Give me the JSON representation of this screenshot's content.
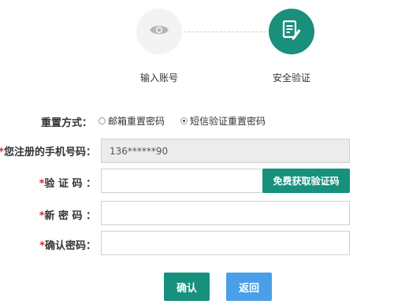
{
  "steps": [
    {
      "label": "输入账号",
      "icon": "eye-icon",
      "state": "inactive"
    },
    {
      "label": "安全验证",
      "icon": "edit-document-icon",
      "state": "active"
    }
  ],
  "form": {
    "reset_method": {
      "label": "重置方式：",
      "options": [
        {
          "label": "邮箱重置密码",
          "checked": false
        },
        {
          "label": "短信验证重置密码",
          "checked": true
        }
      ]
    },
    "phone": {
      "required_mark": "*",
      "label": "您注册的手机号码：",
      "value": "136******90"
    },
    "code": {
      "required_mark": "*",
      "label": "验 证 码 ：",
      "value": "",
      "button": "免费获取验证码"
    },
    "new_password": {
      "required_mark": "*",
      "label": "新 密 码 ：",
      "value": ""
    },
    "confirm_password": {
      "required_mark": "*",
      "label": "确认密码：",
      "value": ""
    }
  },
  "actions": {
    "confirm": "确认",
    "back": "返回"
  },
  "colors": {
    "primary": "#17907d",
    "secondary": "#4a9fe8",
    "required": "#e02b2b"
  }
}
